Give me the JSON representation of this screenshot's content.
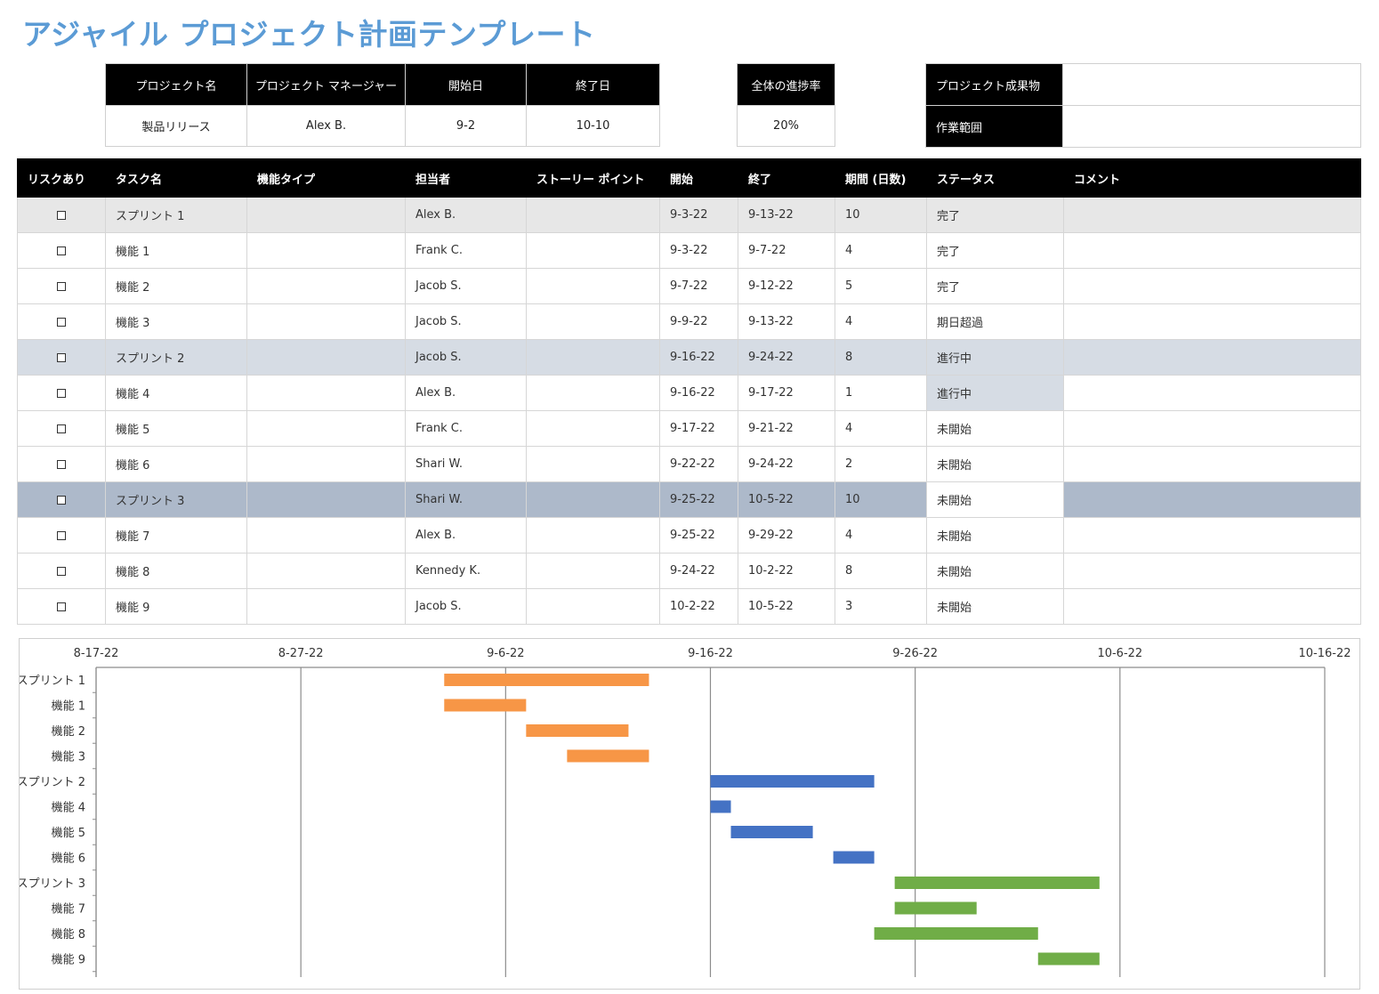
{
  "title": "アジャイル プロジェクト計画テンプレート",
  "project_info": {
    "headers": [
      "プロジェクト名",
      "プロジェクト マネージャー",
      "開始日",
      "終了日"
    ],
    "values": [
      "製品リリース",
      "Alex B.",
      "9-2",
      "10-10"
    ]
  },
  "progress": {
    "header": "全体の進捗率",
    "value": "20%"
  },
  "deliverables": {
    "deliverable_label": "プロジェクト成果物",
    "deliverable_value": "",
    "scope_label": "作業範囲",
    "scope_value": ""
  },
  "task_table": {
    "columns": [
      "リスクあり",
      "タスク名",
      "機能タイプ",
      "担当者",
      "ストーリー ポイント",
      "開始",
      "終了",
      "期間 (日数)",
      "ステータス",
      "コメント"
    ],
    "rows": [
      {
        "risk": false,
        "task": "スプリント 1",
        "type": "",
        "owner": "Alex B.",
        "points": "",
        "start": "9-3-22",
        "end": "9-13-22",
        "days": "10",
        "status": "完了",
        "comment": ""
      },
      {
        "risk": false,
        "task": "機能 1",
        "type": "",
        "owner": "Frank C.",
        "points": "",
        "start": "9-3-22",
        "end": "9-7-22",
        "days": "4",
        "status": "完了",
        "comment": ""
      },
      {
        "risk": false,
        "task": "機能 2",
        "type": "",
        "owner": "Jacob S.",
        "points": "",
        "start": "9-7-22",
        "end": "9-12-22",
        "days": "5",
        "status": "完了",
        "comment": ""
      },
      {
        "risk": false,
        "task": "機能 3",
        "type": "",
        "owner": "Jacob S.",
        "points": "",
        "start": "9-9-22",
        "end": "9-13-22",
        "days": "4",
        "status": "期日超過",
        "comment": ""
      },
      {
        "risk": false,
        "task": "スプリント 2",
        "type": "",
        "owner": "Jacob S.",
        "points": "",
        "start": "9-16-22",
        "end": "9-24-22",
        "days": "8",
        "status": "進行中",
        "comment": ""
      },
      {
        "risk": false,
        "task": "機能 4",
        "type": "",
        "owner": "Alex B.",
        "points": "",
        "start": "9-16-22",
        "end": "9-17-22",
        "days": "1",
        "status": "進行中",
        "comment": ""
      },
      {
        "risk": false,
        "task": "機能 5",
        "type": "",
        "owner": "Frank C.",
        "points": "",
        "start": "9-17-22",
        "end": "9-21-22",
        "days": "4",
        "status": "未開始",
        "comment": ""
      },
      {
        "risk": false,
        "task": "機能 6",
        "type": "",
        "owner": "Shari W.",
        "points": "",
        "start": "9-22-22",
        "end": "9-24-22",
        "days": "2",
        "status": "未開始",
        "comment": ""
      },
      {
        "risk": false,
        "task": "スプリント 3",
        "type": "",
        "owner": "Shari W.",
        "points": "",
        "start": "9-25-22",
        "end": "10-5-22",
        "days": "10",
        "status": "未開始",
        "comment": ""
      },
      {
        "risk": false,
        "task": "機能 7",
        "type": "",
        "owner": "Alex B.",
        "points": "",
        "start": "9-25-22",
        "end": "9-29-22",
        "days": "4",
        "status": "未開始",
        "comment": ""
      },
      {
        "risk": false,
        "task": "機能 8",
        "type": "",
        "owner": "Kennedy K.",
        "points": "",
        "start": "9-24-22",
        "end": "10-2-22",
        "days": "8",
        "status": "未開始",
        "comment": ""
      },
      {
        "risk": false,
        "task": "機能 9",
        "type": "",
        "owner": "Jacob S.",
        "points": "",
        "start": "10-2-22",
        "end": "10-5-22",
        "days": "3",
        "status": "未開始",
        "comment": ""
      }
    ]
  },
  "colors": {
    "title": "#5b9bd5",
    "sprint1_row": "#e7e7e7",
    "sprint2_row": "#d6dce4",
    "sprint3_row": "#adb9ca",
    "bar_orange": "#f79646",
    "bar_blue": "#4472c4",
    "bar_green": "#70ad47"
  },
  "chart_data": {
    "type": "gantt",
    "x_tick_labels": [
      "8-17-22",
      "8-27-22",
      "9-6-22",
      "9-16-22",
      "9-26-22",
      "10-6-22",
      "10-16-22"
    ],
    "xlim": [
      "2022-08-17",
      "2022-10-16"
    ],
    "grid": true,
    "categories": [
      "スプリント 1",
      "機能 1",
      "機能 2",
      "機能 3",
      "スプリント 2",
      "機能 4",
      "機能 5",
      "機能 6",
      "スプリント 3",
      "機能 7",
      "機能 8",
      "機能 9"
    ],
    "bars": [
      {
        "label": "スプリント 1",
        "start": "2022-09-03",
        "end": "2022-09-13",
        "color": "#f79646"
      },
      {
        "label": "機能 1",
        "start": "2022-09-03",
        "end": "2022-09-07",
        "color": "#f79646"
      },
      {
        "label": "機能 2",
        "start": "2022-09-07",
        "end": "2022-09-12",
        "color": "#f79646"
      },
      {
        "label": "機能 3",
        "start": "2022-09-09",
        "end": "2022-09-13",
        "color": "#f79646"
      },
      {
        "label": "スプリント 2",
        "start": "2022-09-16",
        "end": "2022-09-24",
        "color": "#4472c4"
      },
      {
        "label": "機能 4",
        "start": "2022-09-16",
        "end": "2022-09-17",
        "color": "#4472c4"
      },
      {
        "label": "機能 5",
        "start": "2022-09-17",
        "end": "2022-09-21",
        "color": "#4472c4"
      },
      {
        "label": "機能 6",
        "start": "2022-09-22",
        "end": "2022-09-24",
        "color": "#4472c4"
      },
      {
        "label": "スプリント 3",
        "start": "2022-09-25",
        "end": "2022-10-05",
        "color": "#70ad47"
      },
      {
        "label": "機能 7",
        "start": "2022-09-25",
        "end": "2022-09-29",
        "color": "#70ad47"
      },
      {
        "label": "機能 8",
        "start": "2022-09-24",
        "end": "2022-10-02",
        "color": "#70ad47"
      },
      {
        "label": "機能 9",
        "start": "2022-10-02",
        "end": "2022-10-05",
        "color": "#70ad47"
      }
    ]
  }
}
